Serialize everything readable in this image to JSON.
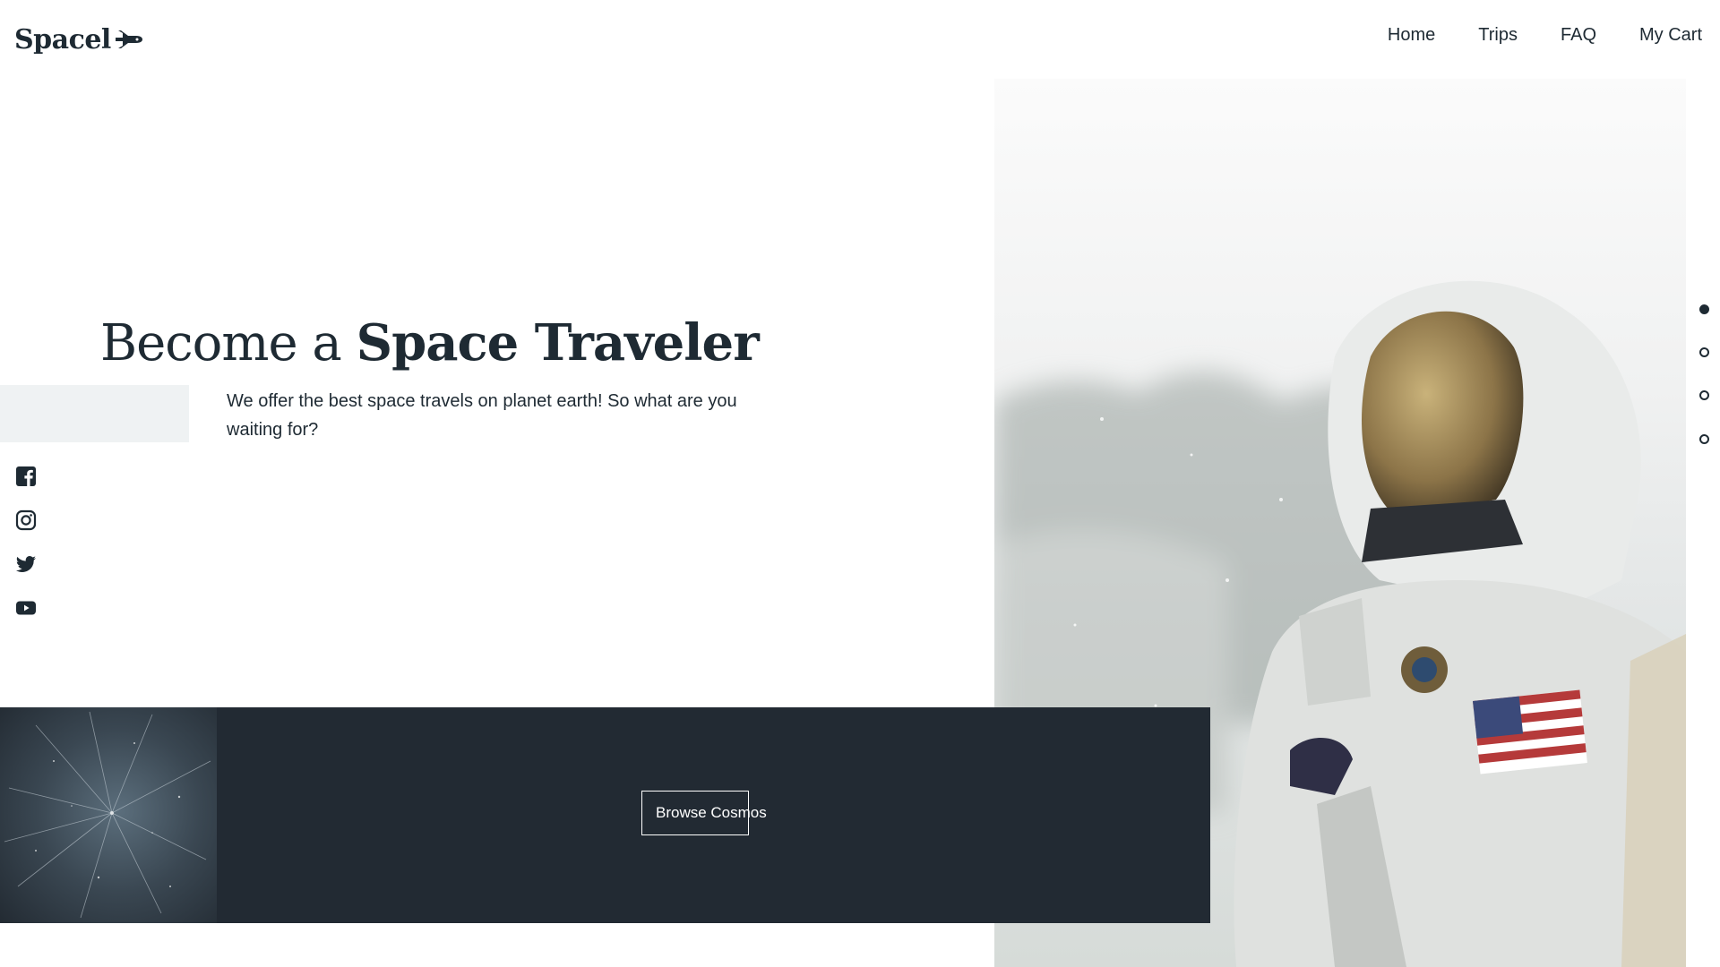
{
  "brand": {
    "name": "Spacel",
    "icon": "shuttle-icon"
  },
  "nav": [
    {
      "label": "Home"
    },
    {
      "label": "Trips"
    },
    {
      "label": "FAQ"
    },
    {
      "label": "My Cart"
    }
  ],
  "hero": {
    "headline_light": "Become a",
    "headline_bold": "Space Traveler",
    "lead": "We offer the best space travels on planet earth! So what are you waiting for?",
    "cta_label": "Browse Cosmos",
    "image": "astronaut-photo"
  },
  "social": [
    {
      "icon": "facebook-icon"
    },
    {
      "icon": "instagram-icon"
    },
    {
      "icon": "twitter-icon"
    },
    {
      "icon": "youtube-icon"
    }
  ],
  "slider": {
    "count": 4,
    "active_index": 0
  },
  "colors": {
    "text": "#1e2a33",
    "dark_band": "#222a33",
    "grey_block": "#eff2f3",
    "background": "#ffffff"
  }
}
